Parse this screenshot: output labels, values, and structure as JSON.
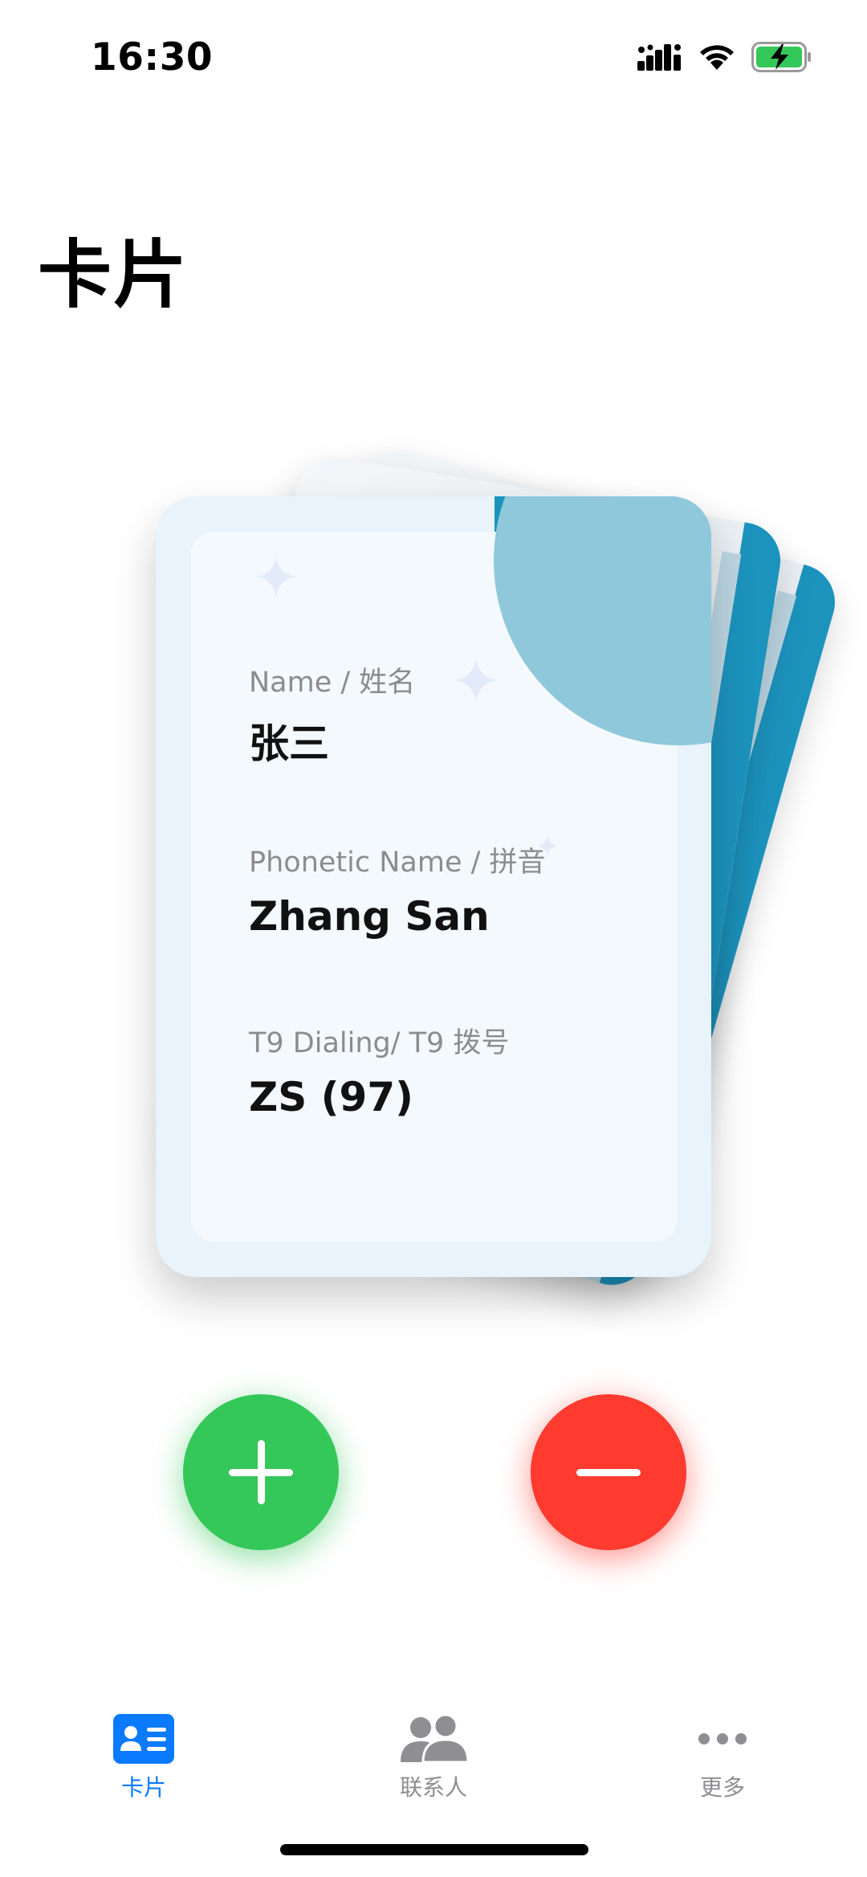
{
  "status_bar": {
    "time": "16:30"
  },
  "page": {
    "title": "卡片"
  },
  "card": {
    "fields": [
      {
        "label": "Name / 姓名",
        "value": "张三"
      },
      {
        "label": "Phonetic Name / 拼音",
        "value": "Zhang San"
      },
      {
        "label": "T9 Dialing/ T9 拨号",
        "value": "ZS (97)"
      }
    ]
  },
  "actions": {
    "add_icon": "plus-icon",
    "remove_icon": "minus-icon",
    "add_color": "#34c759",
    "remove_color": "#ff3b30"
  },
  "tab_bar": {
    "items": [
      {
        "label": "卡片",
        "icon": "card-icon",
        "active": true
      },
      {
        "label": "联系人",
        "icon": "contacts-icon",
        "active": false
      },
      {
        "label": "更多",
        "icon": "more-icon",
        "active": false
      }
    ],
    "active_color": "#0a7aff",
    "inactive_color": "#8e8e93"
  },
  "colors": {
    "card_accent": "#1c93bd",
    "card_background": "#e8f3fc"
  }
}
